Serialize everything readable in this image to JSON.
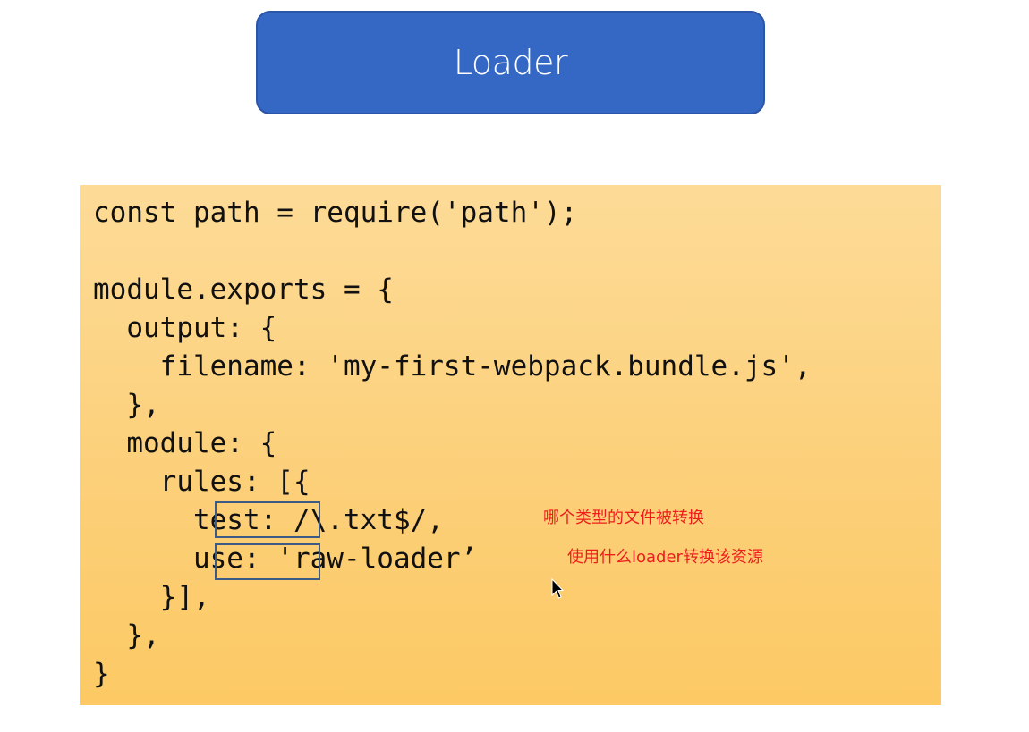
{
  "title": "Loader",
  "code": {
    "lines": [
      "const path = require('path');",
      "",
      "module.exports = {",
      "  output: {",
      "    filename: 'my-first-webpack.bundle.js',",
      "  },",
      "  module: {",
      "    rules: [{",
      "      test: /\\.txt$/,",
      "      use: 'raw-loader’",
      "    }],",
      "  },",
      "}"
    ]
  },
  "annotations": {
    "test_note": "哪个类型的文件被转换",
    "use_note": "使用什么loader转换该资源"
  },
  "colors": {
    "title_bg": "#3567c4",
    "panel_bg": "#fcd07a",
    "note": "#ee1d1d",
    "box_border": "#3b5a86"
  }
}
